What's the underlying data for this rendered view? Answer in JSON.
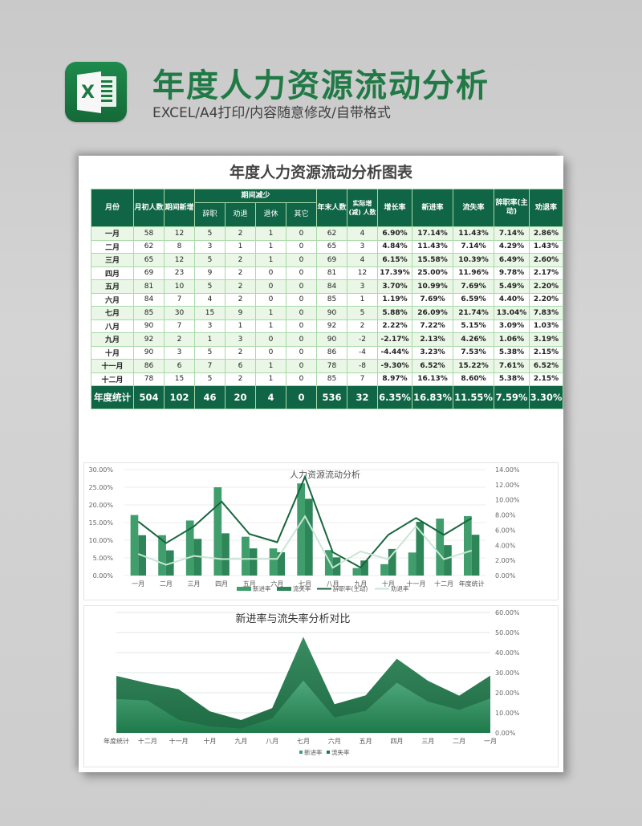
{
  "header": {
    "logo_letter": "X",
    "title": "年度人力资源流动分析",
    "subtitle": "EXCEL/A4打印/内容随意修改/自带格式"
  },
  "sheet": {
    "title": "年度人力资源流动分析图表",
    "columns": {
      "month": "月份",
      "start": "月初人数",
      "new": "期间新增",
      "decrease_group": "期间减少",
      "resign": "辞职",
      "dismiss": "劝退",
      "retire": "退休",
      "other": "其它",
      "end": "年末人数",
      "net": "实际增(减) 人数",
      "growth": "增长率",
      "new_rate": "新进率",
      "loss_rate": "流失率",
      "resign_rate": "辞职率(主动)",
      "dismiss_rate": "劝退率"
    },
    "rows": [
      [
        "一月",
        "58",
        "12",
        "5",
        "2",
        "1",
        "0",
        "62",
        "4",
        "6.90%",
        "17.14%",
        "11.43%",
        "7.14%",
        "2.86%"
      ],
      [
        "二月",
        "62",
        "8",
        "3",
        "1",
        "1",
        "0",
        "65",
        "3",
        "4.84%",
        "11.43%",
        "7.14%",
        "4.29%",
        "1.43%"
      ],
      [
        "三月",
        "65",
        "12",
        "5",
        "2",
        "1",
        "0",
        "69",
        "4",
        "6.15%",
        "15.58%",
        "10.39%",
        "6.49%",
        "2.60%"
      ],
      [
        "四月",
        "69",
        "23",
        "9",
        "2",
        "0",
        "0",
        "81",
        "12",
        "17.39%",
        "25.00%",
        "11.96%",
        "9.78%",
        "2.17%"
      ],
      [
        "五月",
        "81",
        "10",
        "5",
        "2",
        "0",
        "0",
        "84",
        "3",
        "3.70%",
        "10.99%",
        "7.69%",
        "5.49%",
        "2.20%"
      ],
      [
        "六月",
        "84",
        "7",
        "4",
        "2",
        "0",
        "0",
        "85",
        "1",
        "1.19%",
        "7.69%",
        "6.59%",
        "4.40%",
        "2.20%"
      ],
      [
        "七月",
        "85",
        "30",
        "15",
        "9",
        "1",
        "0",
        "90",
        "5",
        "5.88%",
        "26.09%",
        "21.74%",
        "13.04%",
        "7.83%"
      ],
      [
        "八月",
        "90",
        "7",
        "3",
        "1",
        "1",
        "0",
        "92",
        "2",
        "2.22%",
        "7.22%",
        "5.15%",
        "3.09%",
        "1.03%"
      ],
      [
        "九月",
        "92",
        "2",
        "1",
        "3",
        "0",
        "0",
        "90",
        "-2",
        "-2.17%",
        "2.13%",
        "4.26%",
        "1.06%",
        "3.19%"
      ],
      [
        "十月",
        "90",
        "3",
        "5",
        "2",
        "0",
        "0",
        "86",
        "-4",
        "-4.44%",
        "3.23%",
        "7.53%",
        "5.38%",
        "2.15%"
      ],
      [
        "十一月",
        "86",
        "6",
        "7",
        "6",
        "1",
        "0",
        "78",
        "-8",
        "-9.30%",
        "6.52%",
        "15.22%",
        "7.61%",
        "6.52%"
      ],
      [
        "十二月",
        "78",
        "15",
        "5",
        "2",
        "1",
        "0",
        "85",
        "7",
        "8.97%",
        "16.13%",
        "8.60%",
        "5.38%",
        "2.15%"
      ]
    ],
    "total": [
      "年度统计",
      "504",
      "102",
      "46",
      "20",
      "4",
      "0",
      "536",
      "32",
      "6.35%",
      "16.83%",
      "11.55%",
      "7.59%",
      "3.30%"
    ]
  },
  "colors": {
    "brand_green": "#217a46",
    "header_green": "#0f6545",
    "bar_new": "#3f9e6c",
    "bar_loss": "#2e8558",
    "line_resign": "#17663d",
    "line_dismiss": "#c8e6d4"
  },
  "chart_data": [
    {
      "type": "bar",
      "title": "人力资源流动分析",
      "categories": [
        "一月",
        "二月",
        "三月",
        "四月",
        "五月",
        "六月",
        "七月",
        "八月",
        "九月",
        "十月",
        "十一月",
        "十二月",
        "年度统计"
      ],
      "series": [
        {
          "name": "新进率",
          "kind": "bar",
          "axis": "left",
          "values": [
            17.14,
            11.43,
            15.58,
            25.0,
            10.99,
            7.69,
            26.09,
            7.22,
            2.13,
            3.23,
            6.52,
            16.13,
            16.83
          ]
        },
        {
          "name": "流失率",
          "kind": "bar",
          "axis": "left",
          "values": [
            11.43,
            7.14,
            10.39,
            11.96,
            7.69,
            6.59,
            21.74,
            5.15,
            4.26,
            7.53,
            15.22,
            8.6,
            11.55
          ]
        },
        {
          "name": "辞职率(主动)",
          "kind": "line",
          "axis": "right",
          "values": [
            7.14,
            4.29,
            6.49,
            9.78,
            5.49,
            4.4,
            13.04,
            3.09,
            1.06,
            5.38,
            7.61,
            5.38,
            7.59
          ]
        },
        {
          "name": "劝退率",
          "kind": "line",
          "axis": "right",
          "values": [
            2.86,
            1.43,
            2.6,
            2.17,
            2.2,
            2.2,
            7.83,
            1.03,
            3.19,
            2.15,
            6.52,
            2.15,
            3.3
          ]
        }
      ],
      "left_ticks": [
        "0.00%",
        "5.00%",
        "10.00%",
        "15.00%",
        "20.00%",
        "25.00%",
        "30.00%"
      ],
      "right_ticks": [
        "0.00%",
        "2.00%",
        "4.00%",
        "6.00%",
        "8.00%",
        "10.00%",
        "12.00%",
        "14.00%"
      ],
      "ylim_left": [
        0,
        30
      ],
      "ylim_right": [
        0,
        14
      ],
      "grid": true,
      "legend": "bottom"
    },
    {
      "type": "area",
      "title": "新进率与流失率分析对比",
      "categories": [
        "年度统计",
        "十二月",
        "十一月",
        "十月",
        "九月",
        "八月",
        "七月",
        "六月",
        "五月",
        "四月",
        "三月",
        "二月",
        "一月"
      ],
      "series": [
        {
          "name": "新进率",
          "values": [
            16.83,
            16.13,
            6.52,
            3.23,
            2.13,
            7.22,
            26.09,
            7.69,
            10.99,
            25.0,
            15.58,
            11.43,
            17.14
          ]
        },
        {
          "name": "流失率",
          "values": [
            11.55,
            8.6,
            15.22,
            7.53,
            4.26,
            5.15,
            21.74,
            6.59,
            7.69,
            11.96,
            10.39,
            7.14,
            11.43
          ]
        }
      ],
      "stacked": true,
      "ticks": [
        "0.00%",
        "10.00%",
        "20.00%",
        "30.00%",
        "40.00%",
        "50.00%",
        "60.00%"
      ],
      "ylim": [
        0,
        60
      ],
      "grid": true,
      "legend": "bottom"
    }
  ]
}
